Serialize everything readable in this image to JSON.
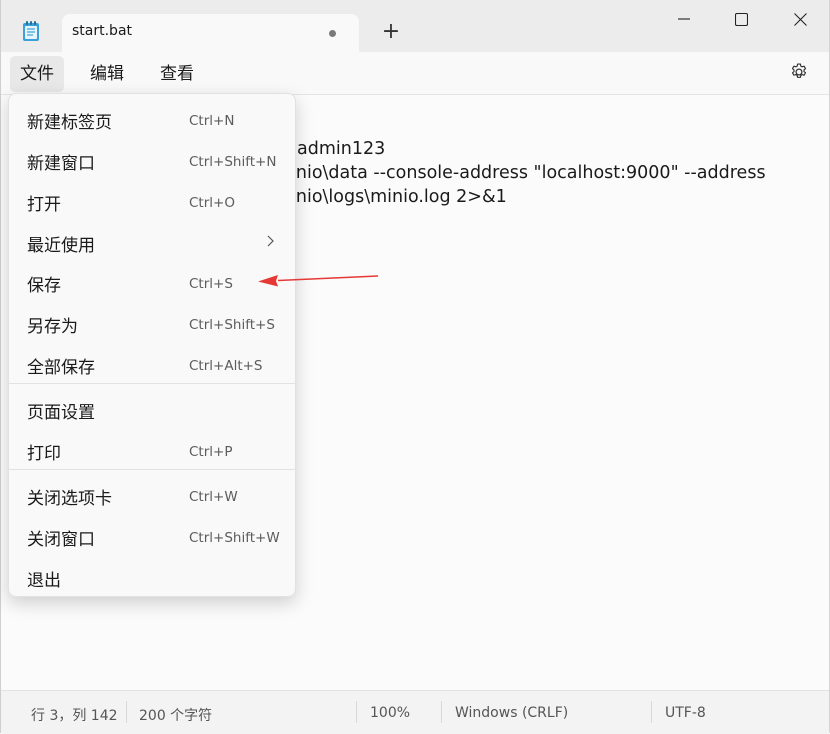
{
  "window": {
    "tab_title": "start.bat",
    "new_tab_glyph": "+"
  },
  "menubar": {
    "items": [
      {
        "label": "文件"
      },
      {
        "label": "编辑"
      },
      {
        "label": "查看"
      }
    ]
  },
  "editor": {
    "visible_lines": [
      "admin123",
      "inio\\data --console-address \"localhost:9000\" --address",
      "inio\\logs\\minio.log 2>&1"
    ]
  },
  "file_menu": {
    "items": [
      {
        "label": "新建标签页",
        "shortcut": "Ctrl+N"
      },
      {
        "label": "新建窗口",
        "shortcut": "Ctrl+Shift+N"
      },
      {
        "label": "打开",
        "shortcut": "Ctrl+O"
      },
      {
        "label": "最近使用",
        "shortcut": ""
      },
      {
        "label": "保存",
        "shortcut": "Ctrl+S"
      },
      {
        "label": "另存为",
        "shortcut": "Ctrl+Shift+S"
      },
      {
        "label": "全部保存",
        "shortcut": "Ctrl+Alt+S"
      },
      {
        "label": "页面设置",
        "shortcut": ""
      },
      {
        "label": "打印",
        "shortcut": "Ctrl+P"
      },
      {
        "label": "关闭选项卡",
        "shortcut": "Ctrl+W"
      },
      {
        "label": "关闭窗口",
        "shortcut": "Ctrl+Shift+W"
      },
      {
        "label": "退出",
        "shortcut": ""
      }
    ]
  },
  "statusbar": {
    "position": "行 3，列 142",
    "char_count": "200 个字符",
    "zoom": "100%",
    "line_ending": "Windows (CRLF)",
    "encoding": "UTF-8"
  },
  "icons": {
    "app": "notepad-icon",
    "settings": "gear-icon",
    "submenu": "chevron-right-icon",
    "minimize": "minimize-icon",
    "maximize": "maximize-icon",
    "close": "close-icon"
  },
  "colors": {
    "annotation_arrow": "#e53935",
    "notepad_icon": "#3aa0d8"
  }
}
